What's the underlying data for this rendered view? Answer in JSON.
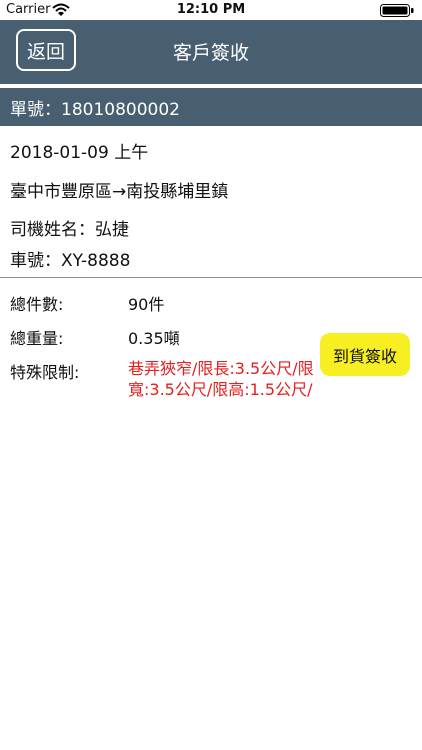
{
  "status_bar": {
    "carrier": "Carrier",
    "time": "12:10 PM",
    "icons": [
      "wifi-icon",
      "battery-icon"
    ]
  },
  "nav": {
    "back_label": "返回",
    "title": "客戶簽收",
    "background_color": "#475f70"
  },
  "order": {
    "number_label": "單號：18010800002"
  },
  "shipment": {
    "date": "2018-01-09 上午",
    "route": "臺中市豐原區→南投縣埔里鎮",
    "driver": "司機姓名：弘捷",
    "vehicle": "車號：XY-8888"
  },
  "details": {
    "total_items_label": "總件數:",
    "total_items_value": "90件",
    "total_weight_label": "總重量:",
    "total_weight_value": "0.35噸",
    "restriction_label": "特殊限制:",
    "restriction_value": "巷弄狹窄/限長:3.5公尺/限寬:3.5公尺/限高:1.5公尺/",
    "restriction_color": "#e61e1e"
  },
  "actions": {
    "sign_label": "到貨簽收",
    "sign_color": "#f7ef22"
  }
}
